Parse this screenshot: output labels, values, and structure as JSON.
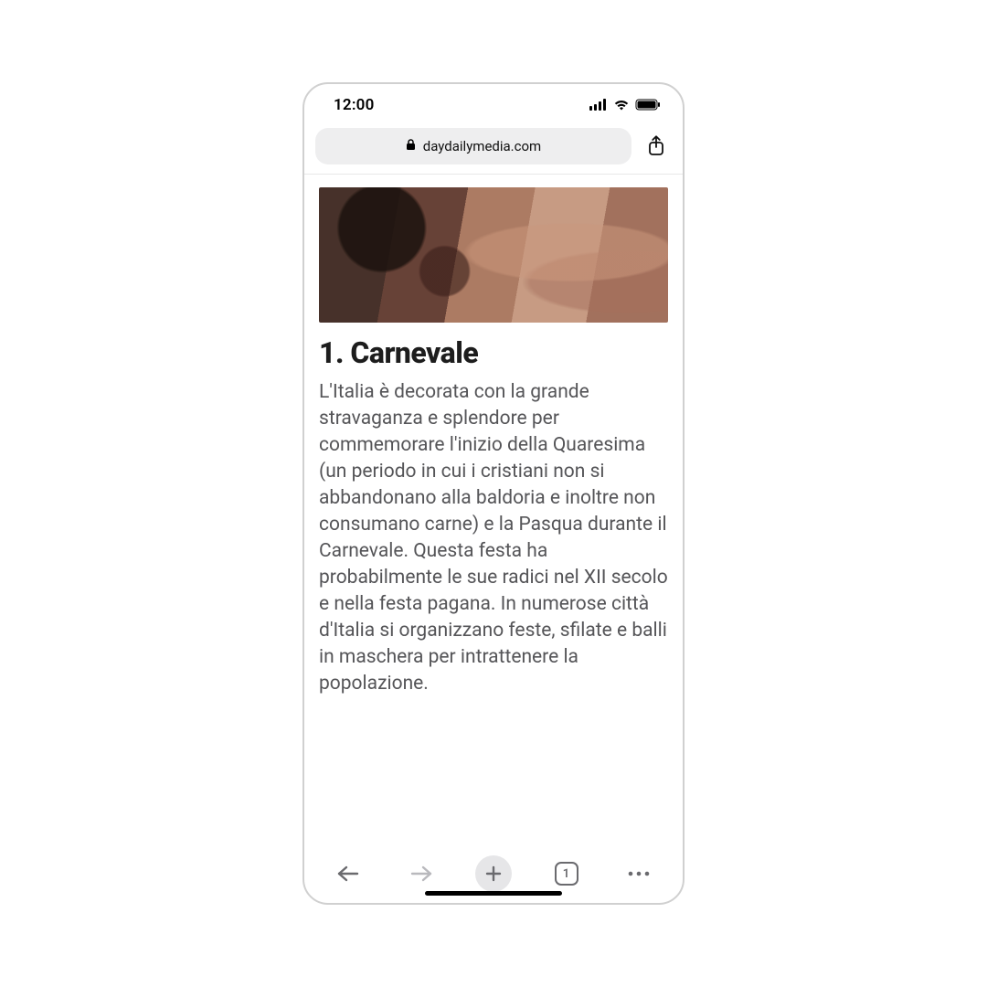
{
  "status": {
    "time": "12:00"
  },
  "urlbar": {
    "domain": "daydailymedia.com"
  },
  "article": {
    "title": "1. Carnevale",
    "body": "L'Italia è decorata con la grande stravaganza e splendore per commemorare l'inizio della Quaresima (un periodo in cui i cristiani non si abbandonano alla baldoria e inoltre non consumano carne) e la Pasqua durante il Carnevale. Questa festa ha probabilmente le sue radici nel XII secolo e nella festa pagana. In numerose città d'Italia si organizzano feste, sfilate e balli in maschera per intrattenere la popolazione."
  },
  "toolbar": {
    "tab_count": "1"
  }
}
